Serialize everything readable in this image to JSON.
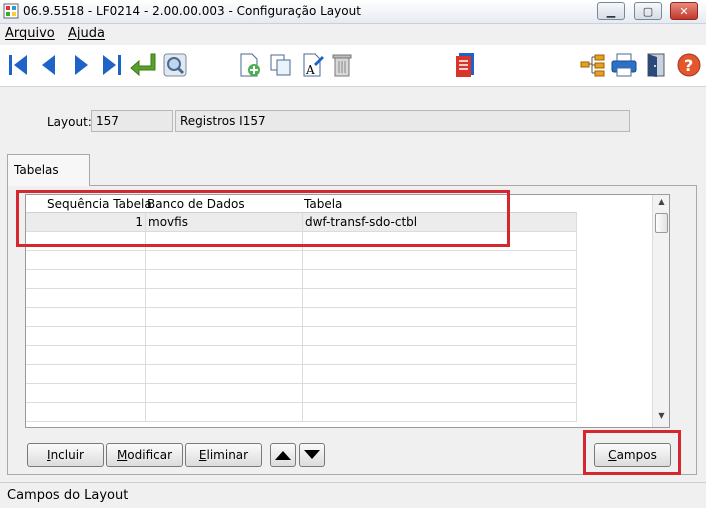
{
  "window": {
    "title": "06.9.5518 - LF0214 - 2.00.00.003 - Configuração Layout",
    "minimize_glyph": "▁",
    "maximize_glyph": "▢",
    "close_glyph": "✕"
  },
  "menu": {
    "items": [
      {
        "label": "Arquivo"
      },
      {
        "label": "Ajuda"
      }
    ]
  },
  "toolbar": {
    "icons": [
      "first-record-icon",
      "previous-record-icon",
      "next-record-icon",
      "last-record-icon",
      "goto-icon",
      "search-icon",
      "new-record-icon",
      "copy-record-icon",
      "edit-record-icon",
      "delete-record-icon",
      "report-icon",
      "tree-icon",
      "print-icon",
      "exit-icon",
      "help-icon"
    ],
    "help_glyph": "?"
  },
  "form": {
    "layout_label": "Layout:",
    "layout_code": "157",
    "layout_description": "Registros I157"
  },
  "tab": {
    "label": "Tabelas"
  },
  "grid": {
    "columns": [
      "Sequência Tabela",
      "Banco de Dados",
      "Tabela"
    ],
    "rows": [
      {
        "sequence": "1",
        "database": "movfis",
        "table": "dwf-transf-sdo-ctbl"
      }
    ]
  },
  "buttons": {
    "incluir_u": "I",
    "incluir_rest": "ncluir",
    "modificar_u": "M",
    "modificar_rest": "odificar",
    "eliminar_u": "E",
    "eliminar_rest": "liminar",
    "campos_u": "C",
    "campos_rest": "ampos"
  },
  "status": {
    "text": "Campos do Layout"
  },
  "colors": {
    "highlight": "#d6262e",
    "nav_blue": "#1e64c8",
    "goto_green": "#5aa02c"
  }
}
